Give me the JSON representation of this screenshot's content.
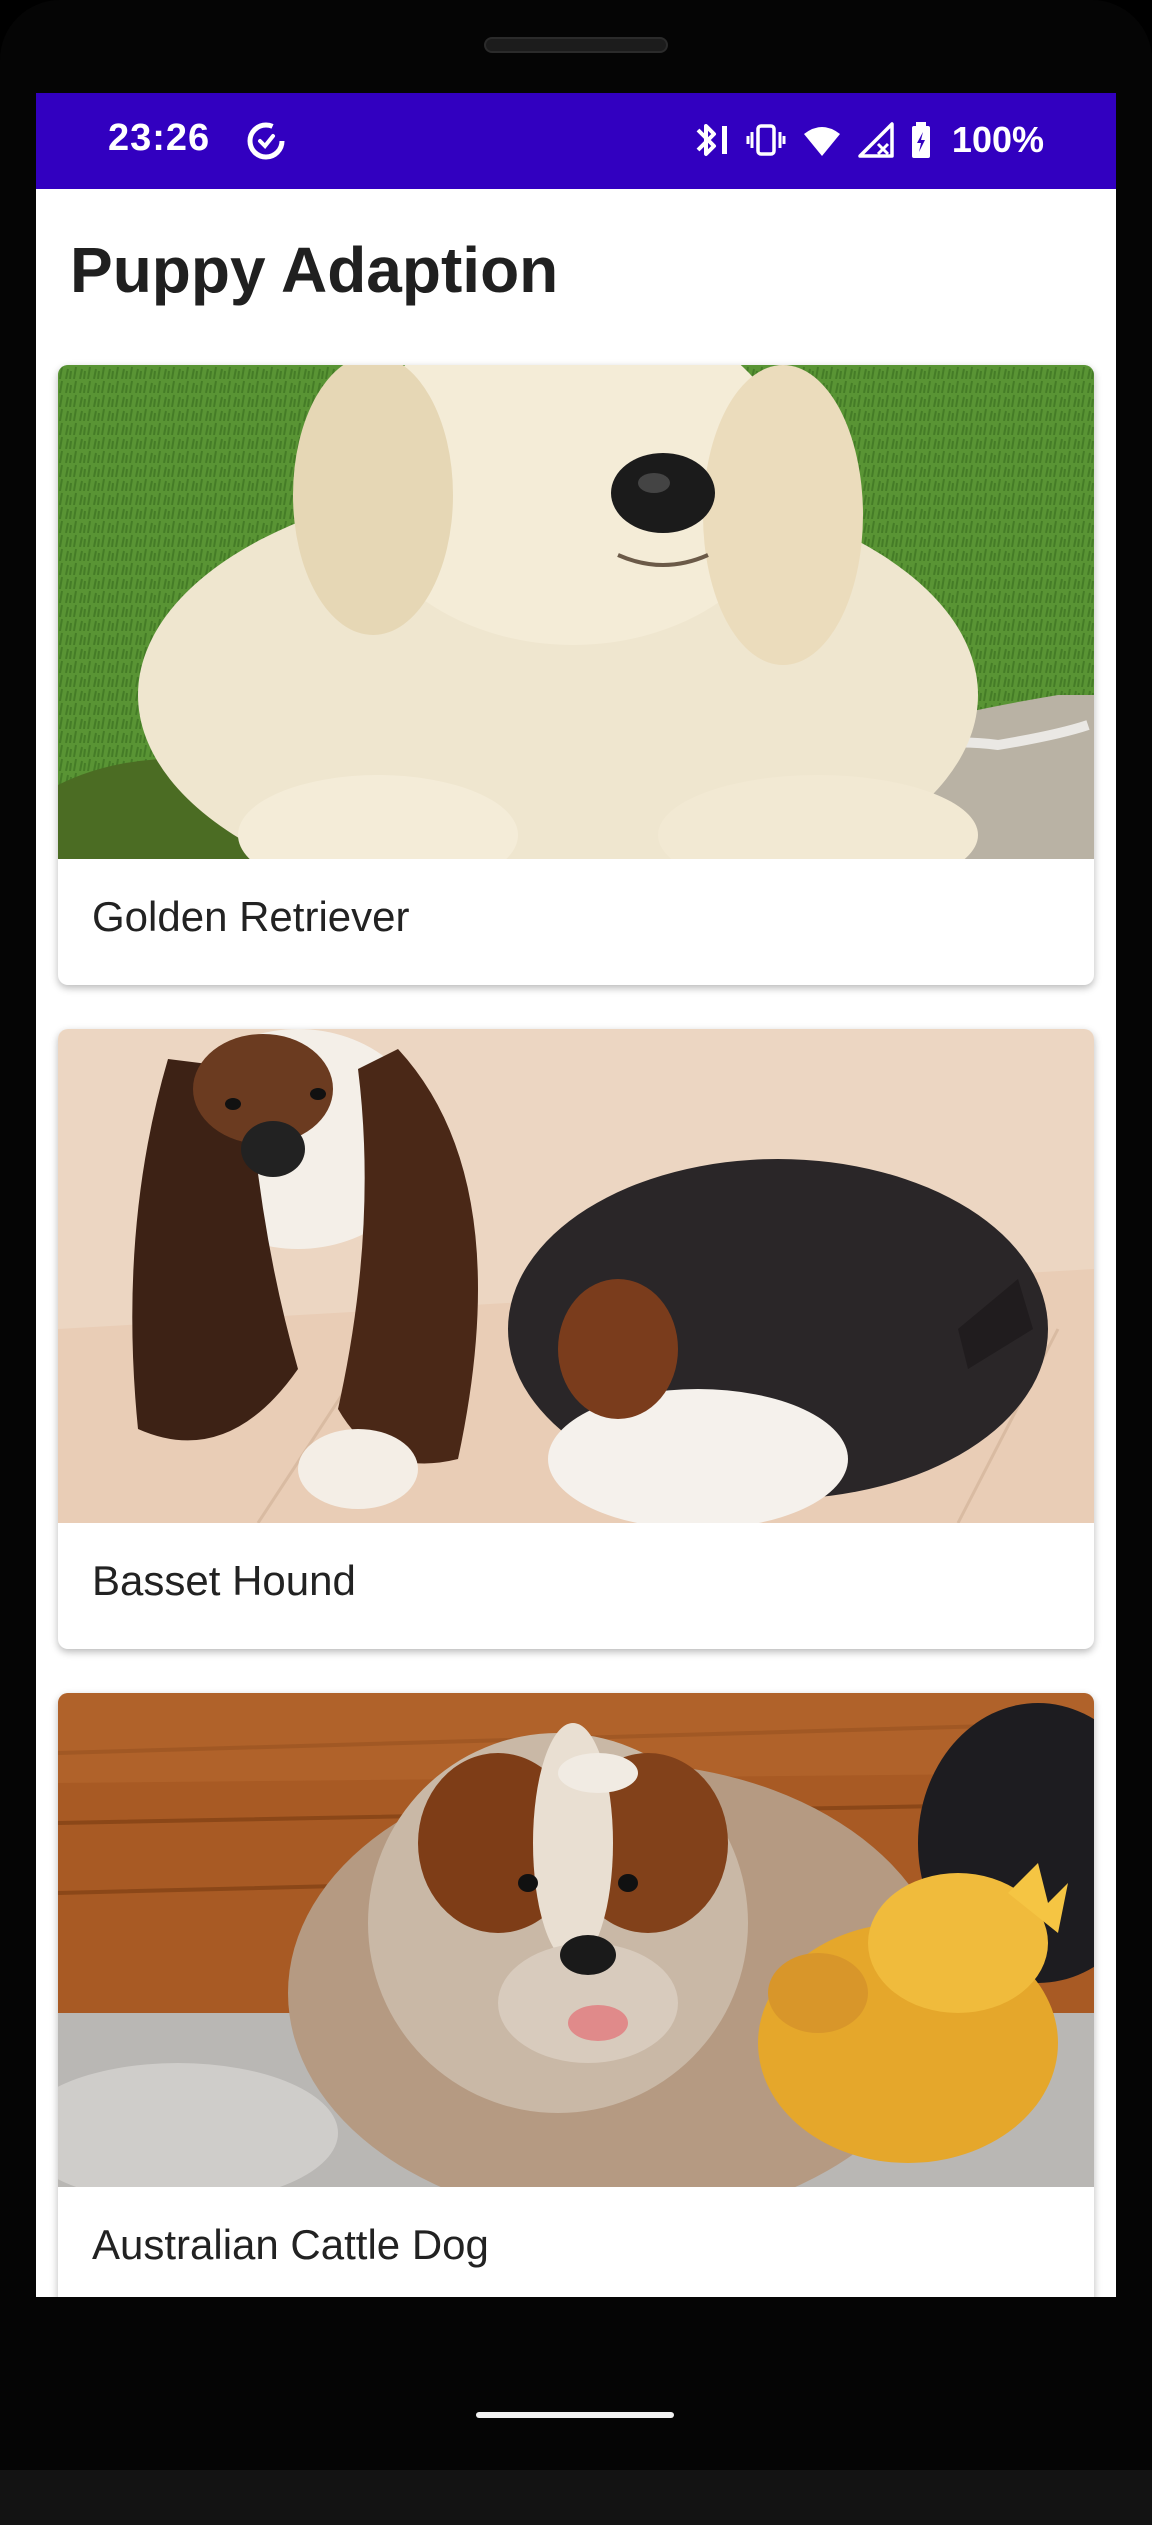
{
  "status_bar": {
    "time": "23:26",
    "battery_percent": "100%",
    "background_color": "#3200c0",
    "icons": [
      "data-saver-icon",
      "bluetooth-icon",
      "vibrate-icon",
      "wifi-icon",
      "signal-off-icon",
      "battery-charging-icon"
    ]
  },
  "app": {
    "title": "Puppy Adaption",
    "puppies": [
      {
        "name": "Golden Retriever",
        "image": "golden-retriever-photo"
      },
      {
        "name": "Basset Hound",
        "image": "basset-hound-photo"
      },
      {
        "name": "Australian Cattle Dog",
        "image": "australian-cattle-dog-photo"
      }
    ]
  }
}
